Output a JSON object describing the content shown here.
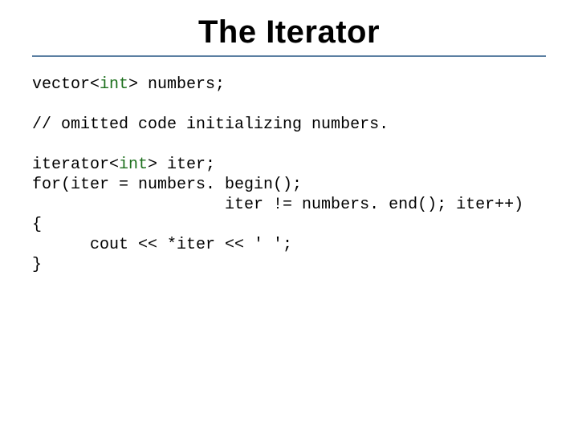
{
  "title": "The Iterator",
  "code": {
    "l1a": "vector<",
    "l1b": "int",
    "l1c": "> numbers;",
    "l2": "",
    "l3": "// omitted code initializing numbers.",
    "l4": "",
    "l5a": "iterator<",
    "l5b": "int",
    "l5c": "> iter;",
    "l6": "for(iter = numbers. begin();",
    "l7": "                    iter != numbers. end(); iter++)",
    "l8": "{",
    "l9": "      cout << *iter << ' ';",
    "l10": "}"
  }
}
